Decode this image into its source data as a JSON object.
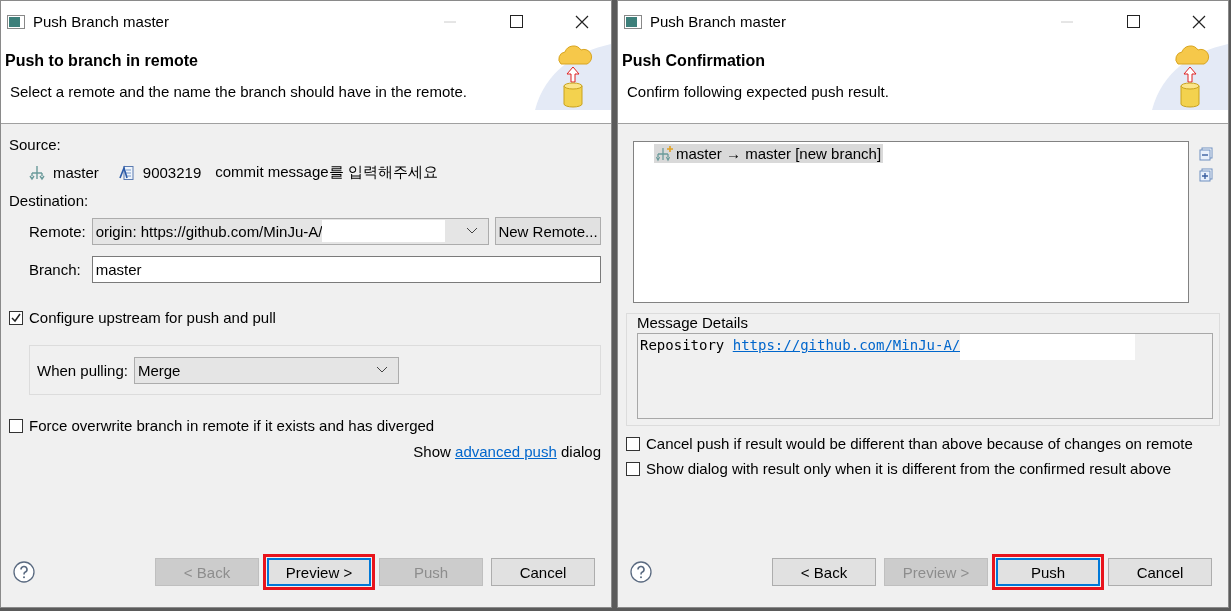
{
  "dialogs": [
    {
      "kind": "branch",
      "title": "Push Branch master",
      "heading": "Push to branch in remote",
      "description": "Select a remote and the name the branch should have in the remote.",
      "source": {
        "label": "Source:",
        "branch": "master",
        "commit_id": "9003219",
        "commit_message": "commit message를 입력해주세요"
      },
      "destination": {
        "label": "Destination:",
        "remote_label": "Remote:",
        "remote_value": "origin: https://github.com/MinJu-A/",
        "remote_redacted": true,
        "new_remote_button": "New Remote...",
        "branch_label": "Branch:",
        "branch_value": "master"
      },
      "upstream": {
        "label": "Configure upstream for push and pull",
        "checked": true
      },
      "pulling": {
        "label": "When pulling:",
        "value": "Merge"
      },
      "force": {
        "label": "Force overwrite branch in remote if it exists and has diverged",
        "checked": false
      },
      "advanced": {
        "prefix": "Show",
        "link": "advanced push",
        "suffix": "dialog"
      },
      "buttons": [
        {
          "label": "< Back",
          "disabled": true,
          "default": false,
          "highlighted": false
        },
        {
          "label": "Preview >",
          "disabled": false,
          "default": true,
          "highlighted": true
        },
        {
          "label": "Push",
          "disabled": true,
          "default": false,
          "highlighted": false
        },
        {
          "label": "Cancel",
          "disabled": false,
          "default": false,
          "highlighted": false
        }
      ]
    },
    {
      "kind": "confirmation",
      "title": "Push Branch master",
      "heading": "Push Confirmation",
      "description": "Confirm following expected push result.",
      "results": [
        {
          "text": "master → master [new branch]",
          "selected": true
        }
      ],
      "message_details": {
        "title": "Message Details",
        "prefix": "Repository",
        "link": "https://github.com/MinJu-A/",
        "redacted": true
      },
      "options": [
        {
          "label": "Cancel push if result would be different than above because of changes on remote",
          "checked": false
        },
        {
          "label": "Show dialog with result only when it is different from the confirmed result above",
          "checked": false
        }
      ],
      "buttons": [
        {
          "label": "< Back",
          "disabled": false,
          "default": false,
          "highlighted": false
        },
        {
          "label": "Preview >",
          "disabled": true,
          "default": false,
          "highlighted": false
        },
        {
          "label": "Push",
          "disabled": false,
          "default": true,
          "highlighted": true
        },
        {
          "label": "Cancel",
          "disabled": false,
          "default": false,
          "highlighted": false
        }
      ]
    }
  ]
}
